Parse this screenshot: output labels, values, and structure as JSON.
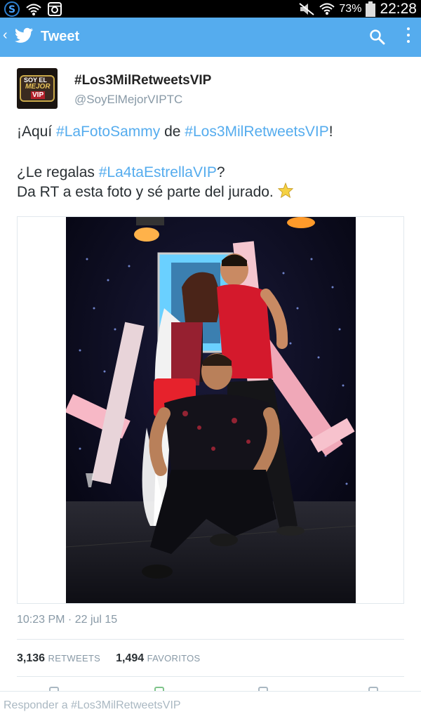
{
  "status_bar": {
    "battery_percent": "73%",
    "time": "22:28",
    "icons": [
      "s-app-icon",
      "wifi-icon",
      "instagram-icon",
      "mute-icon",
      "wifi-icon",
      "battery-icon"
    ]
  },
  "action_bar": {
    "title": "Tweet",
    "icons": [
      "back-icon",
      "twitter-bird-icon",
      "search-icon",
      "overflow-menu-icon"
    ],
    "color": "#55acee"
  },
  "tweet": {
    "user": {
      "name": "#Los3MilRetweetsVIP",
      "handle": "@SoyElMejorVIPTC",
      "avatar_text": [
        "SOY EL",
        "MEJOR",
        "VIP"
      ]
    },
    "text": {
      "line1": {
        "a": "¡Aquí ",
        "b": "#LaFotoSammy",
        "c": " de ",
        "d": "#Los3MilRetweetsVIP",
        "e": "!"
      },
      "line2": {
        "a": "¿Le regalas ",
        "b": "#La4taEstrellaVIP",
        "c": "?"
      },
      "line3": {
        "a": "Da RT a esta foto y sé parte del jurado."
      }
    },
    "timestamp": "10:23 PM · 22 jul 15",
    "stats": {
      "retweets": "3,136",
      "retweets_label": "RETWEETS",
      "favorites": "1,494",
      "favorites_label": "FAVORITOS"
    }
  },
  "reply": {
    "placeholder": "Responder a #Los3MilRetweetsVIP"
  },
  "colors": {
    "hashtag": "#55acee",
    "muted": "#8899a6",
    "text": "#292f33"
  }
}
